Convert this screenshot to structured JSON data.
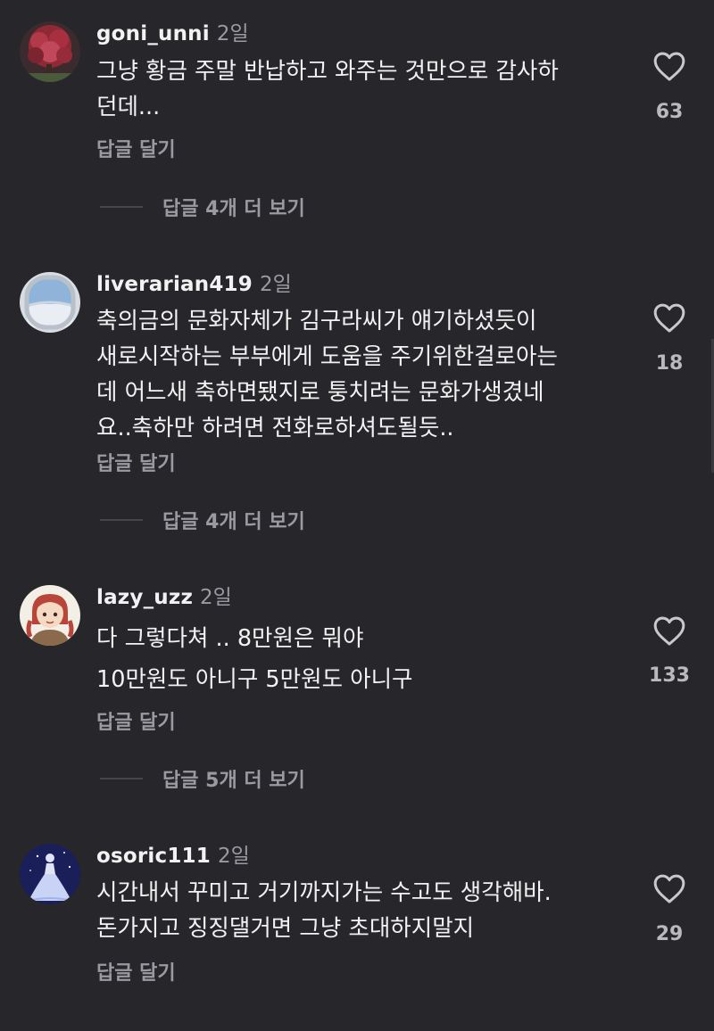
{
  "labels": {
    "reply": "답글 달기"
  },
  "comments": [
    {
      "username": "goni_unni",
      "time": "2일",
      "avatar_icon": "red-flower-tree-avatar",
      "lines": [
        "그냥 황금 주말 반납하고 와주는 것만으로 감사하",
        "던데..."
      ],
      "likes": "63",
      "view_replies": "답글 4개 더 보기"
    },
    {
      "username": "liverarian419",
      "time": "2일",
      "avatar_icon": "airplane-window-avatar",
      "lines": [
        "축의금의 문화자체가  김구라씨가 얘기하셨듯이",
        "새로시작하는 부부에게 도움을 주기위한걸로아는",
        "데 어느새 축하면됐지로 퉁치려는 문화가생겼네",
        "요..축하만 하려면  전화로하셔도될듯.."
      ],
      "likes": "18",
      "view_replies": "답글 4개 더 보기"
    },
    {
      "username": "lazy_uzz",
      "time": "2일",
      "avatar_icon": "anime-girl-avatar",
      "lines": [
        "다 그렇다쳐 .. 8만원은 뭐야",
        "10만원도 아니구 5만원도 아니구"
      ],
      "likes": "133",
      "view_replies": "답글 5개 더 보기"
    },
    {
      "username": "osoric111",
      "time": "2일",
      "avatar_icon": "princess-silhouette-avatar",
      "lines": [
        "시간내서 꾸미고 거기까지가는 수고도 생각해바.",
        "돈가지고 징징댈거면 그냥 초대하지말지"
      ],
      "likes": "29"
    }
  ],
  "colors": {
    "background": "#26262b",
    "text": "#f2f2f2",
    "muted": "#9a9aa0"
  }
}
